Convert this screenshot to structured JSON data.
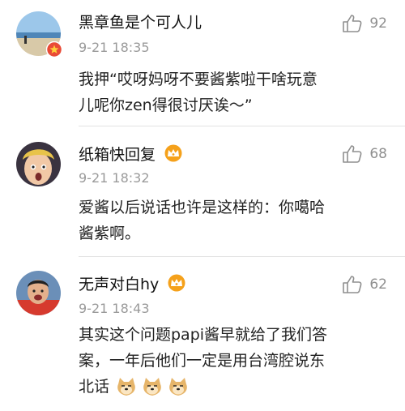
{
  "comments": [
    {
      "username": "黑章鱼是个可人儿",
      "time": "9-21 18:35",
      "likes": "92",
      "text_lines": [
        "我押“哎呀妈呀不要酱紫啦干啥玩意",
        "儿呢你zen得很讨厌诶～”"
      ],
      "avatar": "beach-photo-avatar",
      "badge_icon": "star-badge-icon"
    },
    {
      "username": "纸箱快回复",
      "time": "9-21 18:32",
      "likes": "68",
      "text_lines": [
        "爱酱以后说话也许是这样的：你噶哈",
        "酱紫啊。"
      ],
      "avatar": "surprised-face-avatar",
      "vip_icon": "vip-crown-icon"
    },
    {
      "username": "无声对白hy",
      "time": "9-21 18:43",
      "likes": "62",
      "text_lines": [
        "其实这个问题papi酱早就给了我们答",
        "案，一年后他们一定是用台湾腔说东",
        "北话"
      ],
      "avatar": "athlete-avatar",
      "vip_icon": "vip-crown-icon",
      "trailing_emoji": [
        "doge-emoji",
        "doge-emoji",
        "doge-emoji"
      ]
    }
  ],
  "colors": {
    "like_icon": "#8f8f8f",
    "time": "#9a9a9a",
    "badge_red": "#e94a36",
    "vip_orange": "#f5a11b"
  }
}
